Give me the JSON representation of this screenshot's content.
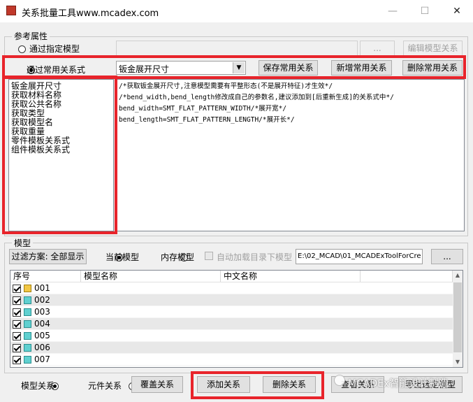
{
  "window": {
    "title": "关系批量工具www.mcadex.com",
    "minimize": "—",
    "maximize": "☐",
    "close": "✕"
  },
  "reference": {
    "legend": "参考属性",
    "radio_model": "通过指定模型",
    "radio_common": "通过常用关系式",
    "btn_browse": "...",
    "btn_edit_model_rel": "编辑模型关系",
    "combo_value": "钣金展开尺寸",
    "btn_save": "保存常用关系",
    "btn_add": "新增常用关系",
    "btn_delete": "删除常用关系",
    "list_items": [
      "钣金展开尺寸",
      "获取材料名称",
      "获取公共名称",
      "获取类型",
      "获取模型名",
      "获取重量",
      "零件模板关系式",
      "组件模板关系式"
    ],
    "code_lines": [
      "/*获取钣金展开尺寸,注意模型需要有平整形态(不是展开特征)才生效*/",
      "/*bend_width,bend_length修改成自己的参数名,建议添加到[后重新生成]的关系式中*/",
      "bend_width=SMT_FLAT_PATTERN_WIDTH/*展开宽*/",
      "bend_length=SMT_FLAT_PATTERN_LENGTH/*展开长*/"
    ]
  },
  "model": {
    "legend": "模型",
    "filter_label": "过滤方案: 全部显示",
    "radio_current": "当前模型",
    "radio_memory": "内存模型",
    "auto_load": "自动加载目录下模型",
    "path": "E:\\02_MCAD\\01_MCADExToolForCre",
    "btn_browse": "...",
    "columns": [
      "序号",
      "模型名称",
      "中文名称"
    ],
    "rows": [
      "001",
      "002",
      "003",
      "004",
      "005",
      "006",
      "007"
    ]
  },
  "footer": {
    "radio_model_rel": "模型关系",
    "radio_comp_rel": "元件关系",
    "btn_overwrite": "覆盖关系",
    "btn_add_rel": "添加关系",
    "btn_delete_rel": "删除关系",
    "btn_view_rel": "查看关系",
    "btn_export": "导出选定模型",
    "watermark": "MCADEx智能设计制造"
  }
}
